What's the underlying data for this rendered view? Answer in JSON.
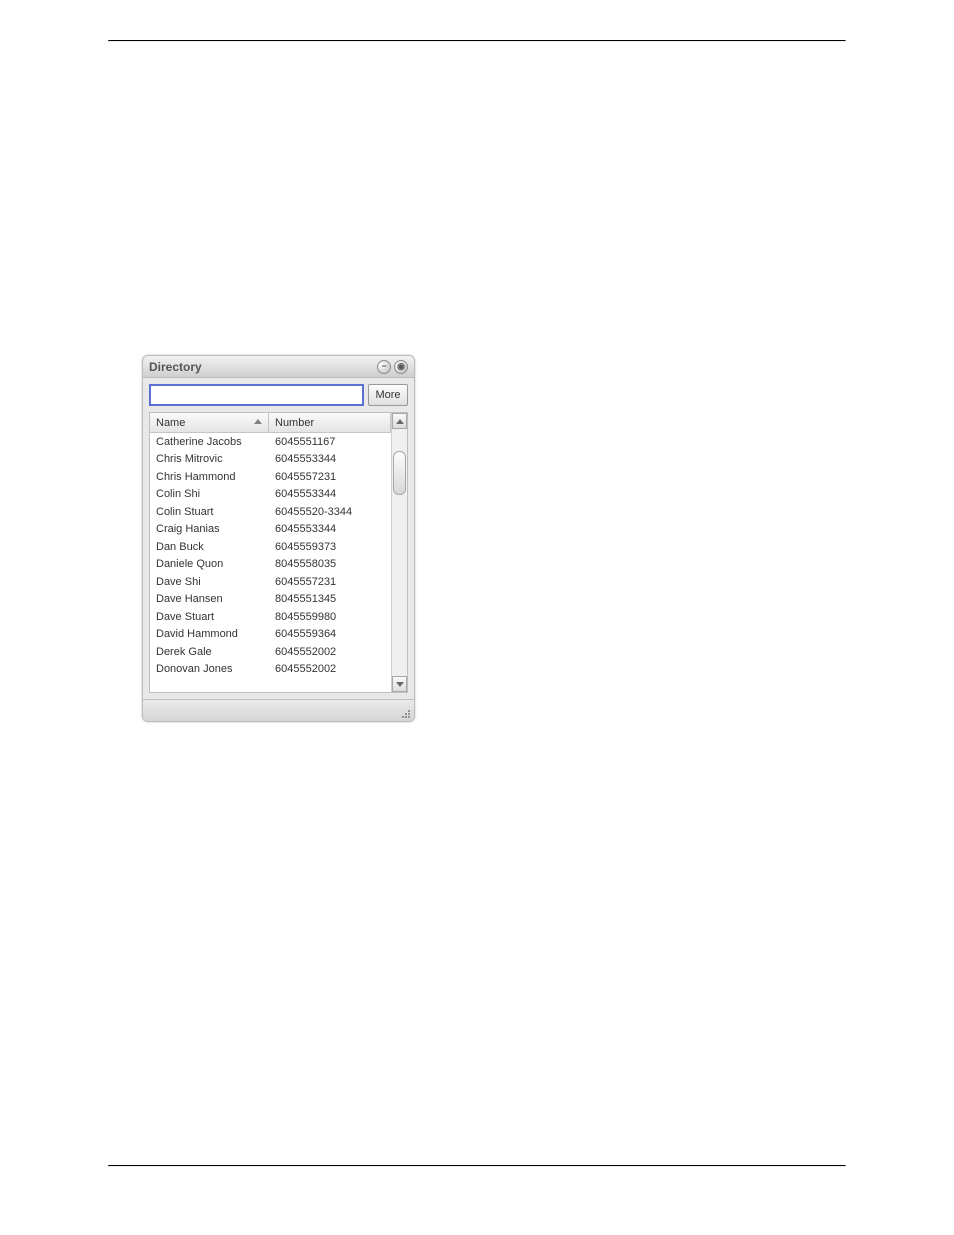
{
  "window": {
    "title": "Directory",
    "more_label": "More",
    "search_value": ""
  },
  "columns": {
    "name": "Name",
    "number": "Number"
  },
  "rows": [
    {
      "name": "Catherine Jacobs",
      "number": "6045551167"
    },
    {
      "name": "Chris  Mitrovic",
      "number": "6045553344"
    },
    {
      "name": "Chris Hammond",
      "number": "6045557231"
    },
    {
      "name": "Colin Shi",
      "number": "6045553344"
    },
    {
      "name": "Colin Stuart",
      "number": "60455520-3344"
    },
    {
      "name": "Craig Hanias",
      "number": "6045553344"
    },
    {
      "name": "Dan Buck",
      "number": "6045559373"
    },
    {
      "name": "Daniele Quon",
      "number": "8045558035"
    },
    {
      "name": "Dave Shi",
      "number": "6045557231"
    },
    {
      "name": "Dave Hansen",
      "number": "8045551345"
    },
    {
      "name": "Dave Stuart",
      "number": "8045559980"
    },
    {
      "name": "David Hammond",
      "number": "6045559364"
    },
    {
      "name": "Derek Gale",
      "number": "6045552002"
    },
    {
      "name": "Donovan  Jones",
      "number": "6045552002"
    }
  ]
}
